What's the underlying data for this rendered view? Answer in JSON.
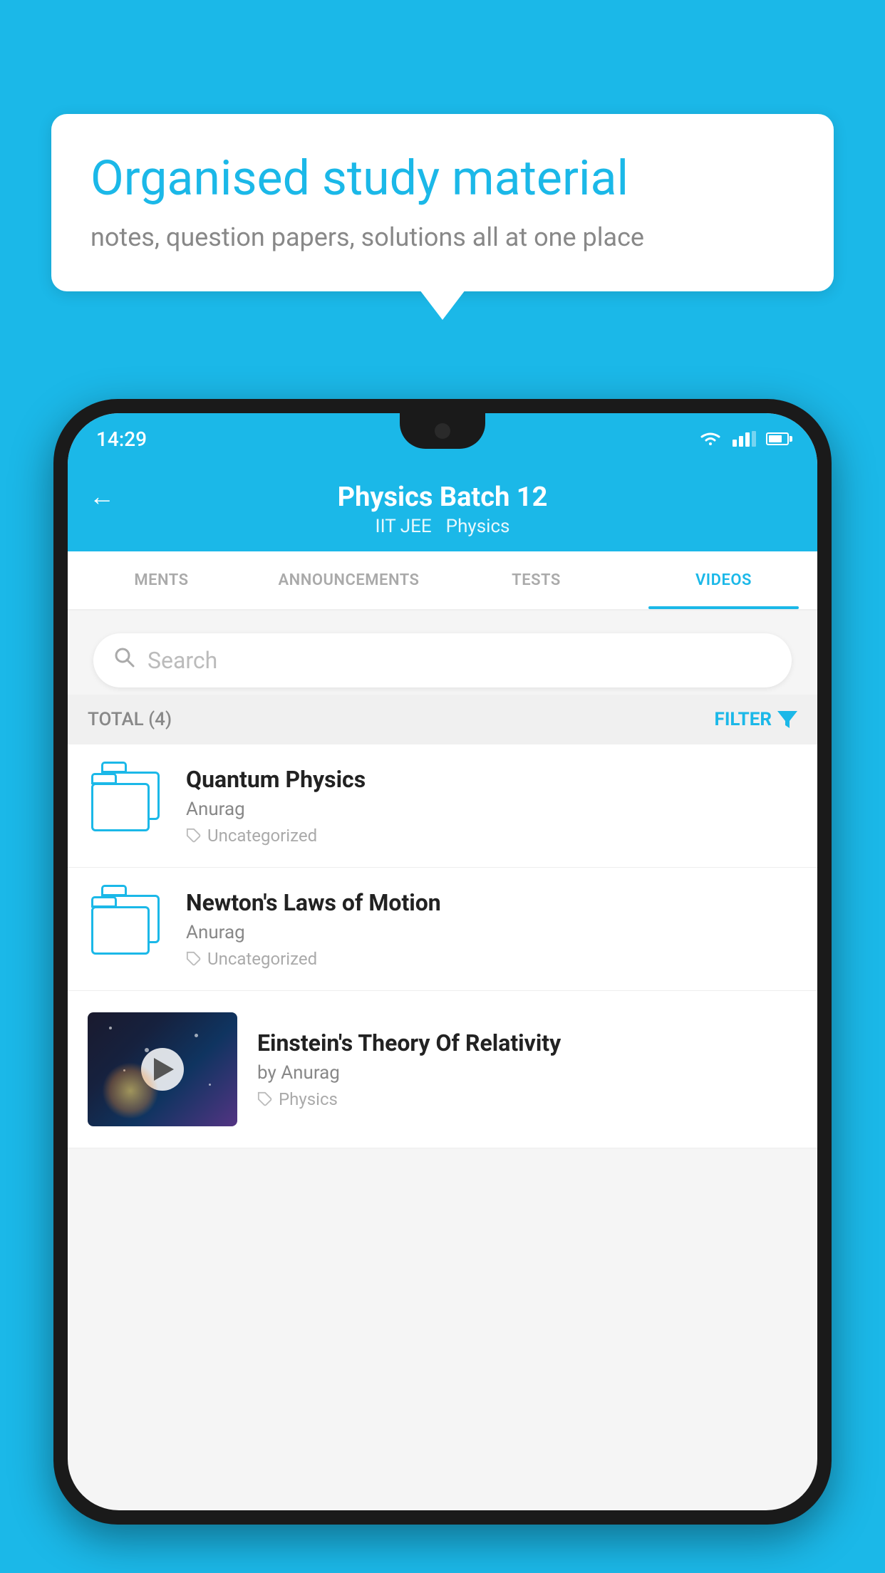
{
  "background": {
    "color": "#1BB8E8"
  },
  "speech_bubble": {
    "title": "Organised study material",
    "subtitle": "notes, question papers, solutions all at one place"
  },
  "phone": {
    "status_bar": {
      "time": "14:29"
    },
    "header": {
      "title": "Physics Batch 12",
      "subtitle1": "IIT JEE",
      "subtitle2": "Physics",
      "back_label": "←"
    },
    "tabs": [
      {
        "label": "MENTS",
        "active": false
      },
      {
        "label": "ANNOUNCEMENTS",
        "active": false
      },
      {
        "label": "TESTS",
        "active": false
      },
      {
        "label": "VIDEOS",
        "active": true
      }
    ],
    "search": {
      "placeholder": "Search"
    },
    "filter": {
      "total_label": "TOTAL (4)",
      "filter_label": "FILTER"
    },
    "videos": [
      {
        "id": 1,
        "title": "Quantum Physics",
        "author": "Anurag",
        "tag": "Uncategorized",
        "type": "folder"
      },
      {
        "id": 2,
        "title": "Newton's Laws of Motion",
        "author": "Anurag",
        "tag": "Uncategorized",
        "type": "folder"
      },
      {
        "id": 3,
        "title": "Einstein's Theory Of Relativity",
        "author": "by Anurag",
        "tag": "Physics",
        "type": "video"
      }
    ]
  }
}
